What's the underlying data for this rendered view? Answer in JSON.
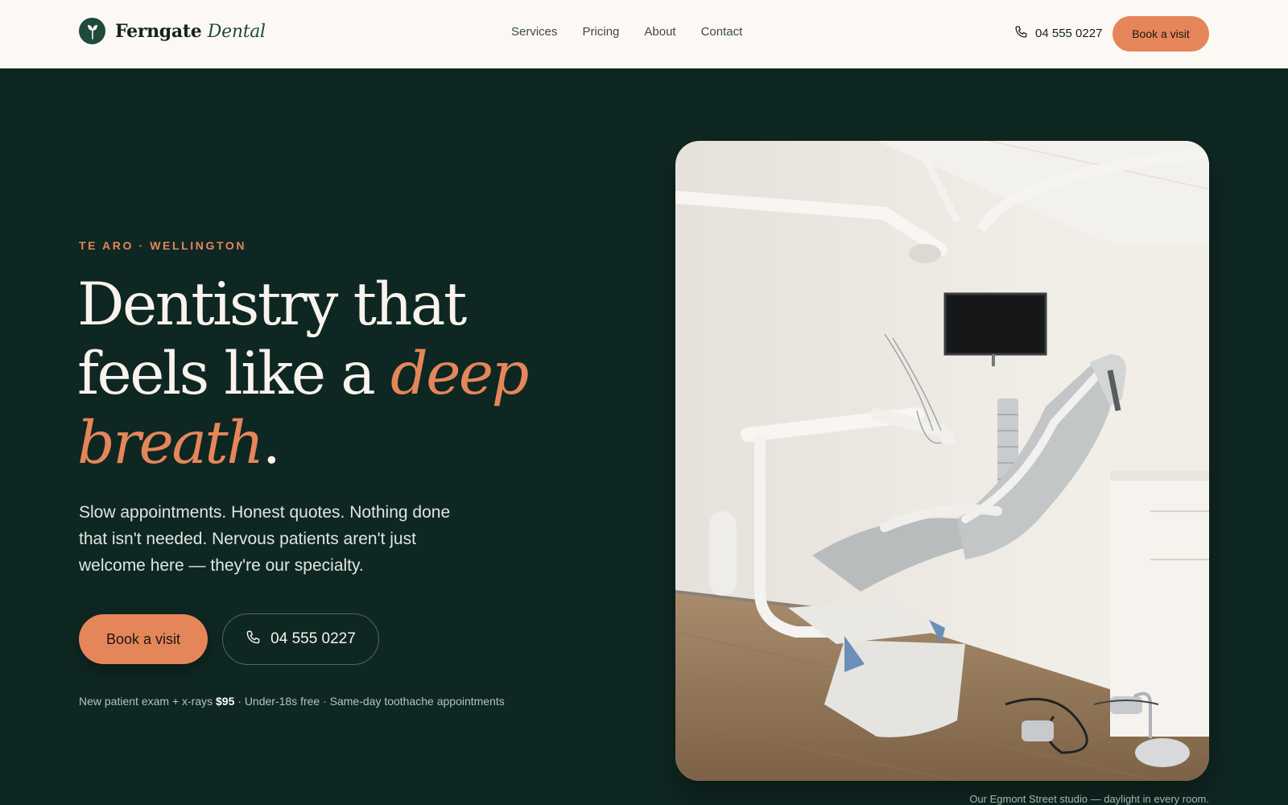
{
  "brand": {
    "name_a": "Ferngate",
    "name_b": "Dental"
  },
  "nav": {
    "items": [
      "Services",
      "Pricing",
      "About",
      "Contact"
    ]
  },
  "header": {
    "phone": "04 555 0227",
    "cta": "Book a visit"
  },
  "hero": {
    "eyebrow": "TE ARO · WELLINGTON",
    "headline_line1": "Dentistry that",
    "headline_line2_a": "feels like a ",
    "headline_line2_b": "deep",
    "headline_line3_a": "breath",
    "headline_line3_b": ".",
    "subtext": "Slow appointments. Honest quotes. Nothing done that isn't needed. Nervous patients aren't just welcome here — they're our specialty.",
    "cta_primary": "Book a visit",
    "cta_phone": "04 555 0227",
    "note_a": "New patient exam + x-rays ",
    "note_price": "$95",
    "note_b": " · Under-18s free · Same-day toothache appointments"
  },
  "photo": {
    "caption": "Our Egmont Street studio — daylight in every room."
  },
  "colors": {
    "accent": "#e5865a",
    "dark": "#0f2722",
    "header_bg": "#fcf9f5",
    "brand_green": "#1f4a3c"
  },
  "icons": {
    "logo": "sprout-icon",
    "phone": "phone-icon"
  }
}
